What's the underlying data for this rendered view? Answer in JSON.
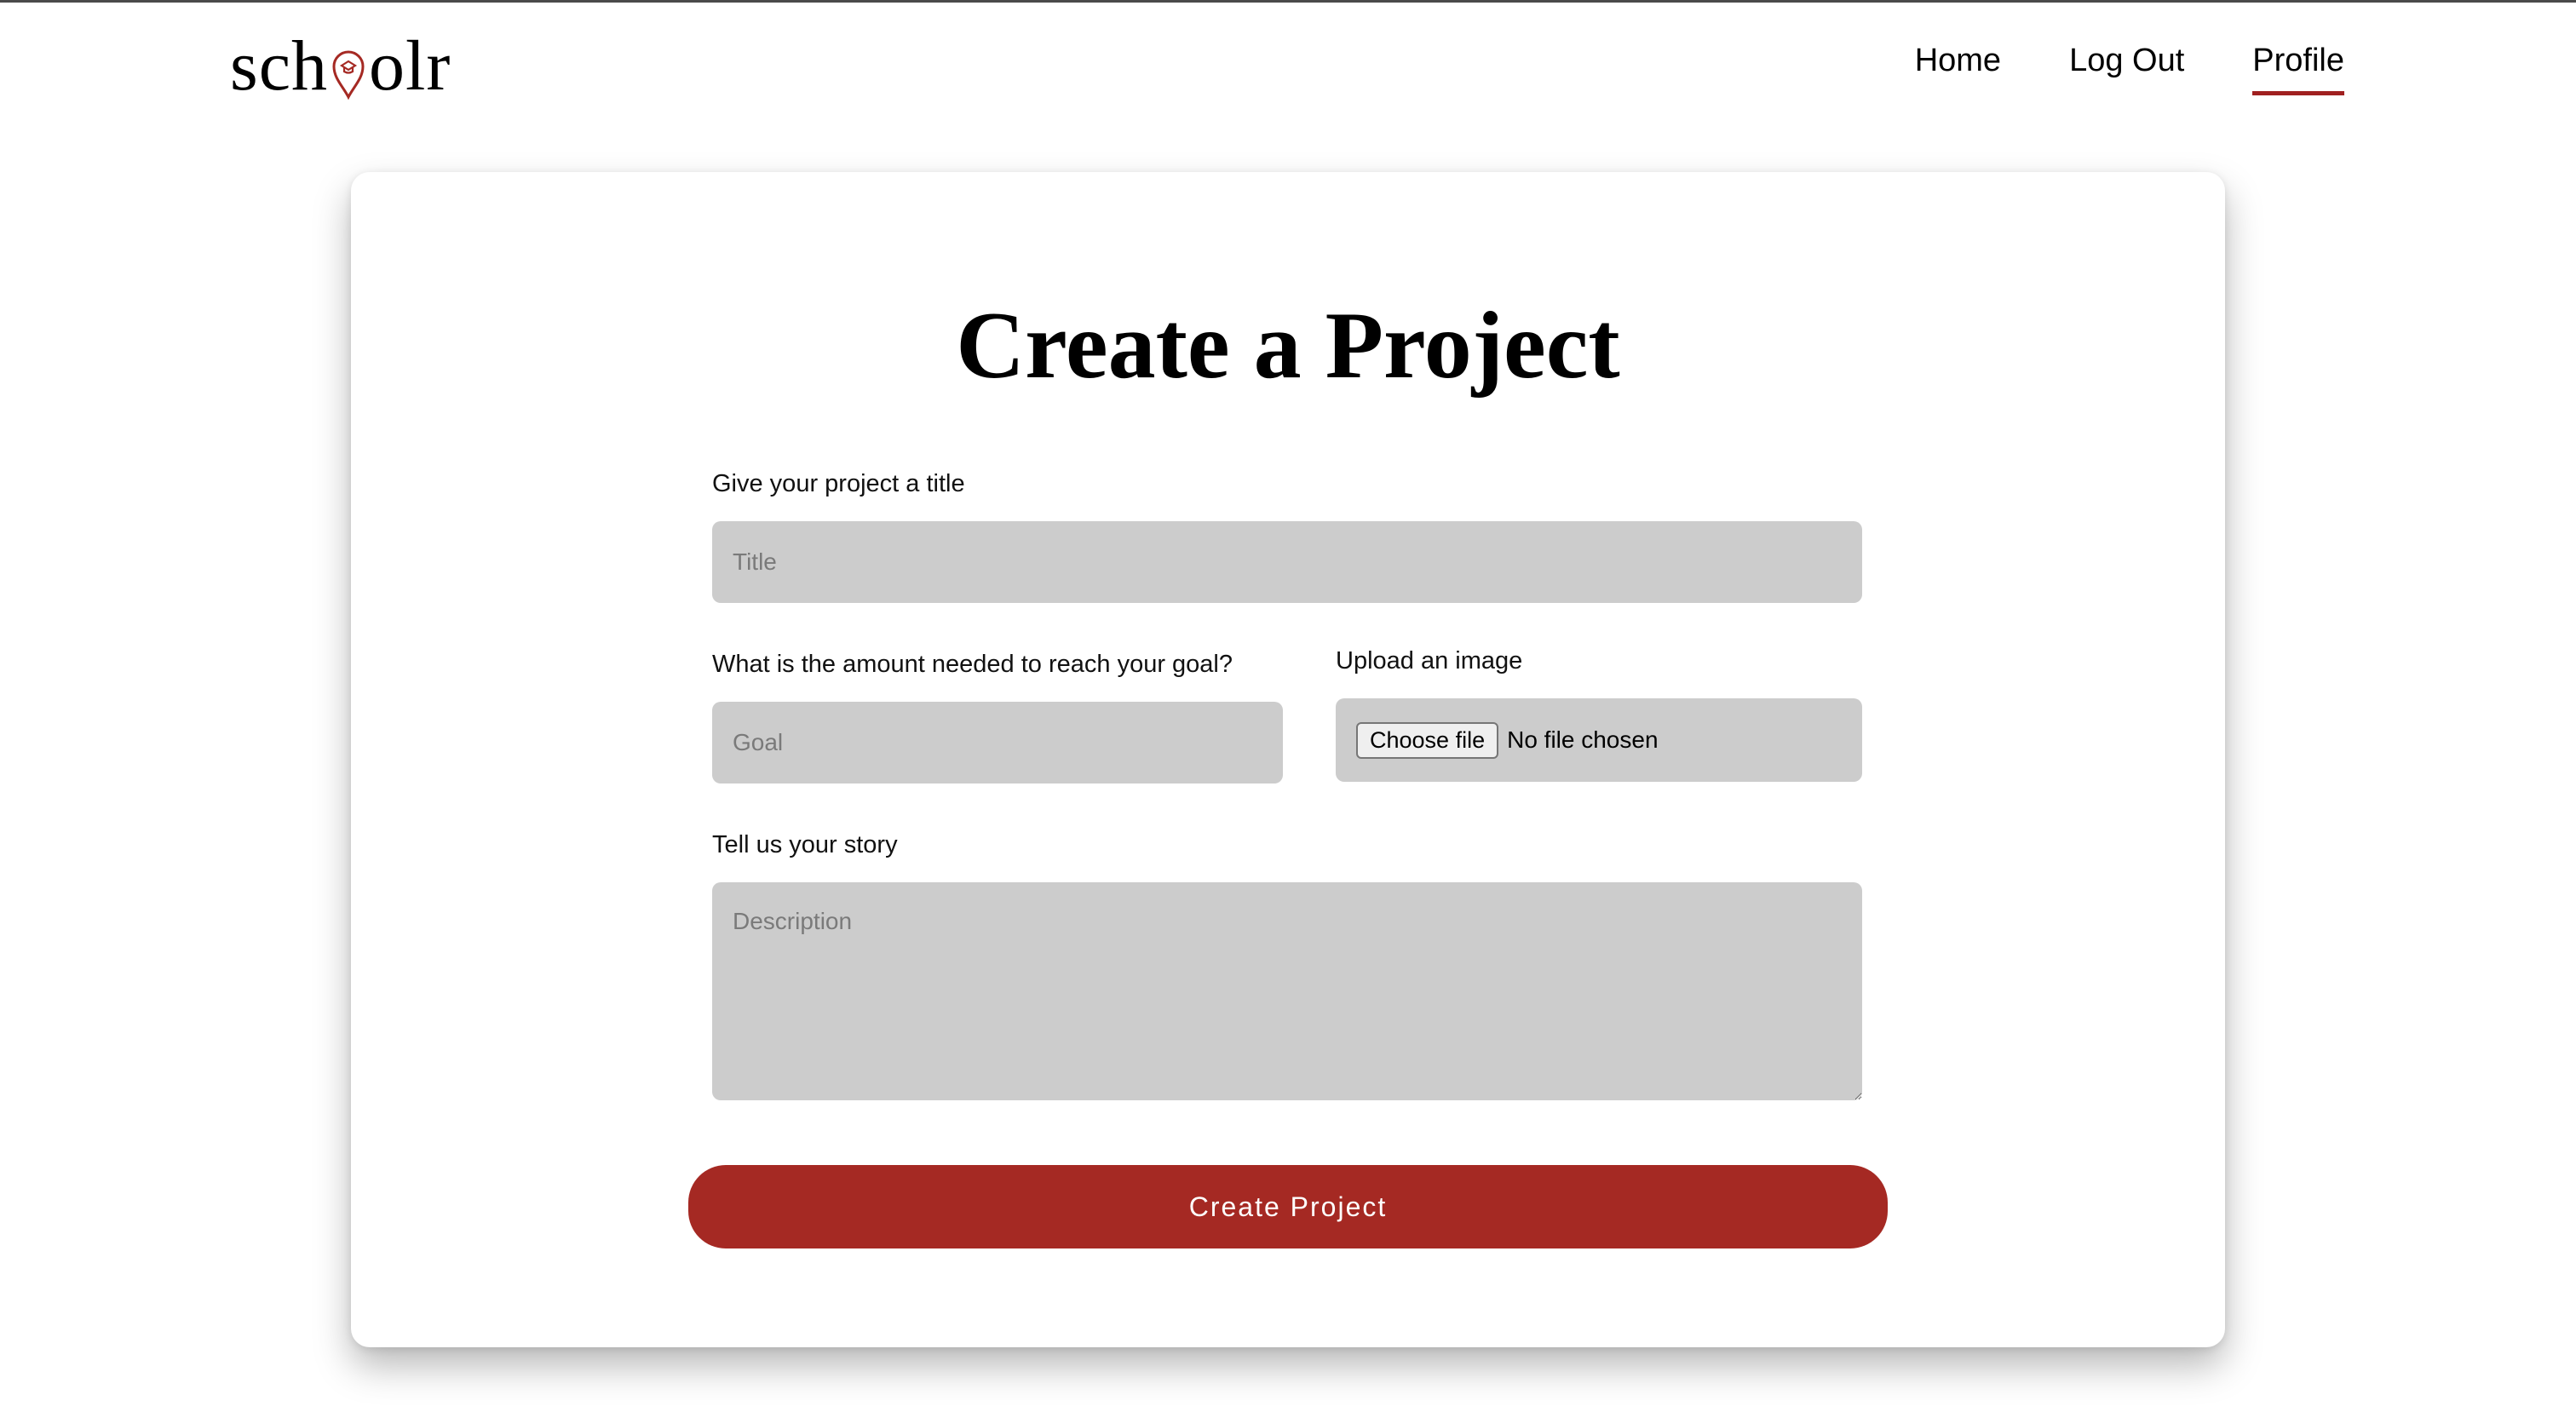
{
  "brand": {
    "name_left": "sch",
    "name_right": "olr",
    "accent_color": "#a52923"
  },
  "nav": {
    "items": [
      {
        "label": "Home",
        "active": false
      },
      {
        "label": "Log Out",
        "active": false
      },
      {
        "label": "Profile",
        "active": true
      }
    ]
  },
  "form": {
    "heading": "Create a Project",
    "title_label": "Give your project a title",
    "title_placeholder": "Title",
    "goal_label": "What is the amount needed to reach your goal?",
    "goal_placeholder": "Goal",
    "image_label": "Upload an image",
    "file_button": "Choose file",
    "file_status": "No file chosen",
    "story_label": "Tell us your story",
    "story_placeholder": "Description",
    "submit_label": "Create Project"
  }
}
